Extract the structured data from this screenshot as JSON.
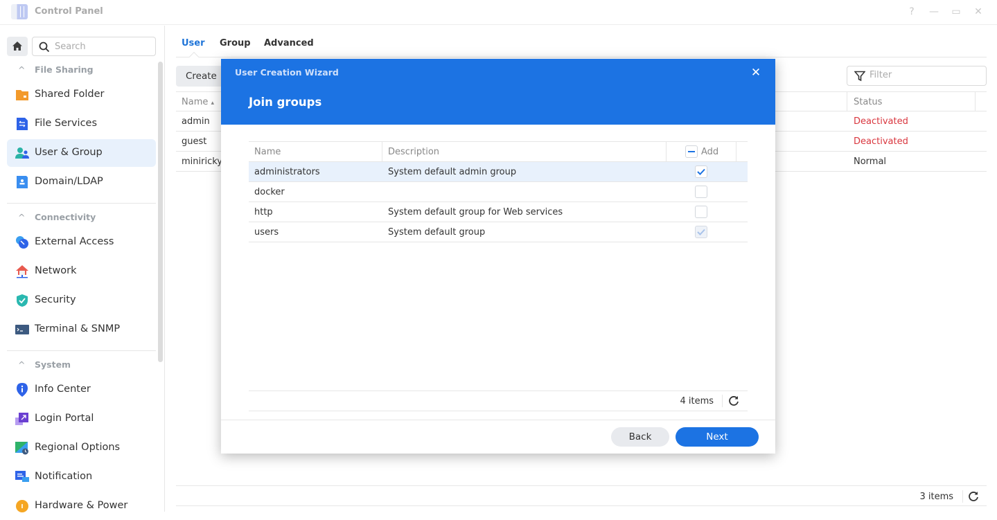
{
  "window": {
    "title": "Control Panel",
    "controls": {
      "help": "?",
      "minimize": "—",
      "maximize": "▭",
      "close": "✕"
    }
  },
  "sidebar": {
    "search_placeholder": "Search",
    "sections": [
      {
        "title": "File Sharing",
        "items": [
          {
            "label": "Shared Folder",
            "icon": "shared-folder-icon"
          },
          {
            "label": "File Services",
            "icon": "file-services-icon"
          },
          {
            "label": "User & Group",
            "icon": "user-group-icon",
            "active": true
          },
          {
            "label": "Domain/LDAP",
            "icon": "domain-ldap-icon"
          }
        ]
      },
      {
        "title": "Connectivity",
        "items": [
          {
            "label": "External Access",
            "icon": "external-access-icon"
          },
          {
            "label": "Network",
            "icon": "network-icon"
          },
          {
            "label": "Security",
            "icon": "security-shield-icon"
          },
          {
            "label": "Terminal & SNMP",
            "icon": "terminal-icon"
          }
        ]
      },
      {
        "title": "System",
        "items": [
          {
            "label": "Info Center",
            "icon": "info-center-icon"
          },
          {
            "label": "Login Portal",
            "icon": "login-portal-icon"
          },
          {
            "label": "Regional Options",
            "icon": "regional-options-icon"
          },
          {
            "label": "Notification",
            "icon": "notification-icon"
          },
          {
            "label": "Hardware & Power",
            "icon": "hardware-power-icon"
          }
        ]
      }
    ]
  },
  "main": {
    "tabs": [
      {
        "label": "User",
        "active": true
      },
      {
        "label": "Group"
      },
      {
        "label": "Advanced"
      }
    ],
    "create_label": "Create",
    "filter_placeholder": "Filter",
    "columns": {
      "name": "Name",
      "name_sort": "▴",
      "status": "Status"
    },
    "rows": [
      {
        "name": "admin",
        "status": "Deactivated",
        "status_type": "deactivated"
      },
      {
        "name": "guest",
        "status": "Deactivated",
        "status_type": "deactivated"
      },
      {
        "name": "miniricky",
        "status": "Normal",
        "status_type": "normal"
      }
    ],
    "item_count": "3 items"
  },
  "dialog": {
    "title": "User Creation Wizard",
    "close": "✕",
    "subtitle": "Join groups",
    "columns": {
      "name": "Name",
      "description": "Description",
      "add": "Add"
    },
    "groups": [
      {
        "name": "administrators",
        "description": "System default admin group",
        "checked": true,
        "disabled": false,
        "selected": true
      },
      {
        "name": "docker",
        "description": "",
        "checked": false,
        "disabled": false,
        "selected": false
      },
      {
        "name": "http",
        "description": "System default group for Web services",
        "checked": false,
        "disabled": false,
        "selected": false
      },
      {
        "name": "users",
        "description": "System default group",
        "checked": true,
        "disabled": true,
        "selected": false
      }
    ],
    "item_count": "4 items",
    "back_label": "Back",
    "next_label": "Next"
  },
  "colors": {
    "accent": "#1c73e3",
    "deactivated": "#d9363e",
    "active_nav_bg": "#e8f1fc"
  }
}
